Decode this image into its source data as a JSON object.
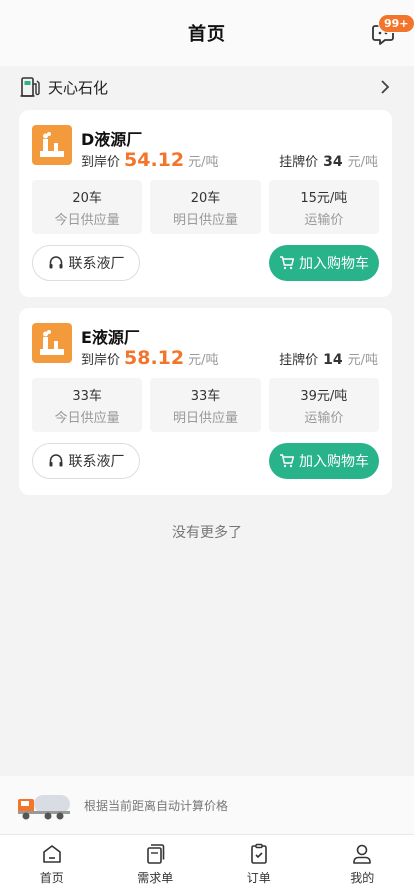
{
  "header": {
    "title": "首页",
    "badge": "99+"
  },
  "company": {
    "name": "天心石化"
  },
  "plants": [
    {
      "name": "D液源厂",
      "price_label": "到岸价",
      "price": "54.12",
      "price_unit": "元/吨",
      "list_label": "挂牌价",
      "list_price": "34",
      "list_unit": "元/吨",
      "stats": [
        {
          "value": "20车",
          "label": "今日供应量"
        },
        {
          "value": "20车",
          "label": "明日供应量"
        },
        {
          "value": "15元/吨",
          "label": "运输价"
        }
      ],
      "contact_label": "联系液厂",
      "cart_label": "加入购物车"
    },
    {
      "name": "E液源厂",
      "price_label": "到岸价",
      "price": "58.12",
      "price_unit": "元/吨",
      "list_label": "挂牌价",
      "list_price": "14",
      "list_unit": "元/吨",
      "stats": [
        {
          "value": "33车",
          "label": "今日供应量"
        },
        {
          "value": "33车",
          "label": "明日供应量"
        },
        {
          "value": "39元/吨",
          "label": "运输价"
        }
      ],
      "contact_label": "联系液厂",
      "cart_label": "加入购物车"
    }
  ],
  "no_more_text": "没有更多了",
  "banner": {
    "text": "根据当前距离自动计算价格"
  },
  "tabs": [
    {
      "label": "首页",
      "icon": "home-icon"
    },
    {
      "label": "需求单",
      "icon": "demand-icon"
    },
    {
      "label": "订单",
      "icon": "clipboard-icon"
    },
    {
      "label": "我的",
      "icon": "user-icon"
    }
  ],
  "colors": {
    "accent": "#29b38a",
    "price": "#f3752b",
    "logo": "#f39a3c"
  }
}
